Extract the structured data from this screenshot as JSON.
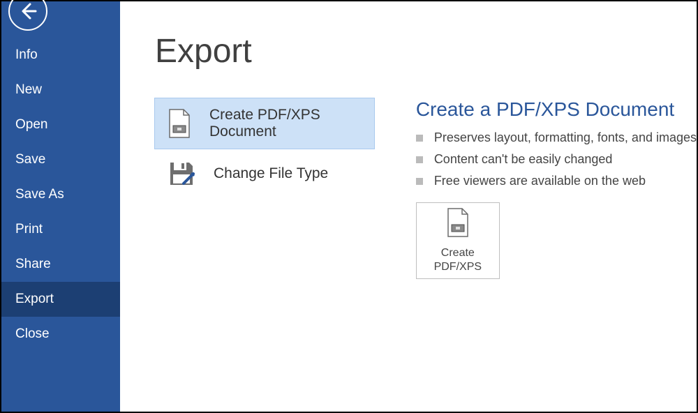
{
  "sidebar": {
    "items": [
      {
        "label": "Info"
      },
      {
        "label": "New"
      },
      {
        "label": "Open"
      },
      {
        "label": "Save"
      },
      {
        "label": "Save As"
      },
      {
        "label": "Print"
      },
      {
        "label": "Share"
      },
      {
        "label": "Export"
      },
      {
        "label": "Close"
      }
    ],
    "selected_index": 7
  },
  "main": {
    "title": "Export",
    "options": [
      {
        "label": "Create PDF/XPS Document",
        "icon": "pdfxps-doc-icon",
        "selected": true
      },
      {
        "label": "Change File Type",
        "icon": "save-disk-icon",
        "selected": false
      }
    ],
    "detail": {
      "title": "Create a PDF/XPS Document",
      "bullets": [
        "Preserves layout, formatting, fonts, and images",
        "Content can't be easily changed",
        "Free viewers are available on the web"
      ],
      "button": {
        "line1": "Create",
        "line2": "PDF/XPS"
      }
    }
  }
}
